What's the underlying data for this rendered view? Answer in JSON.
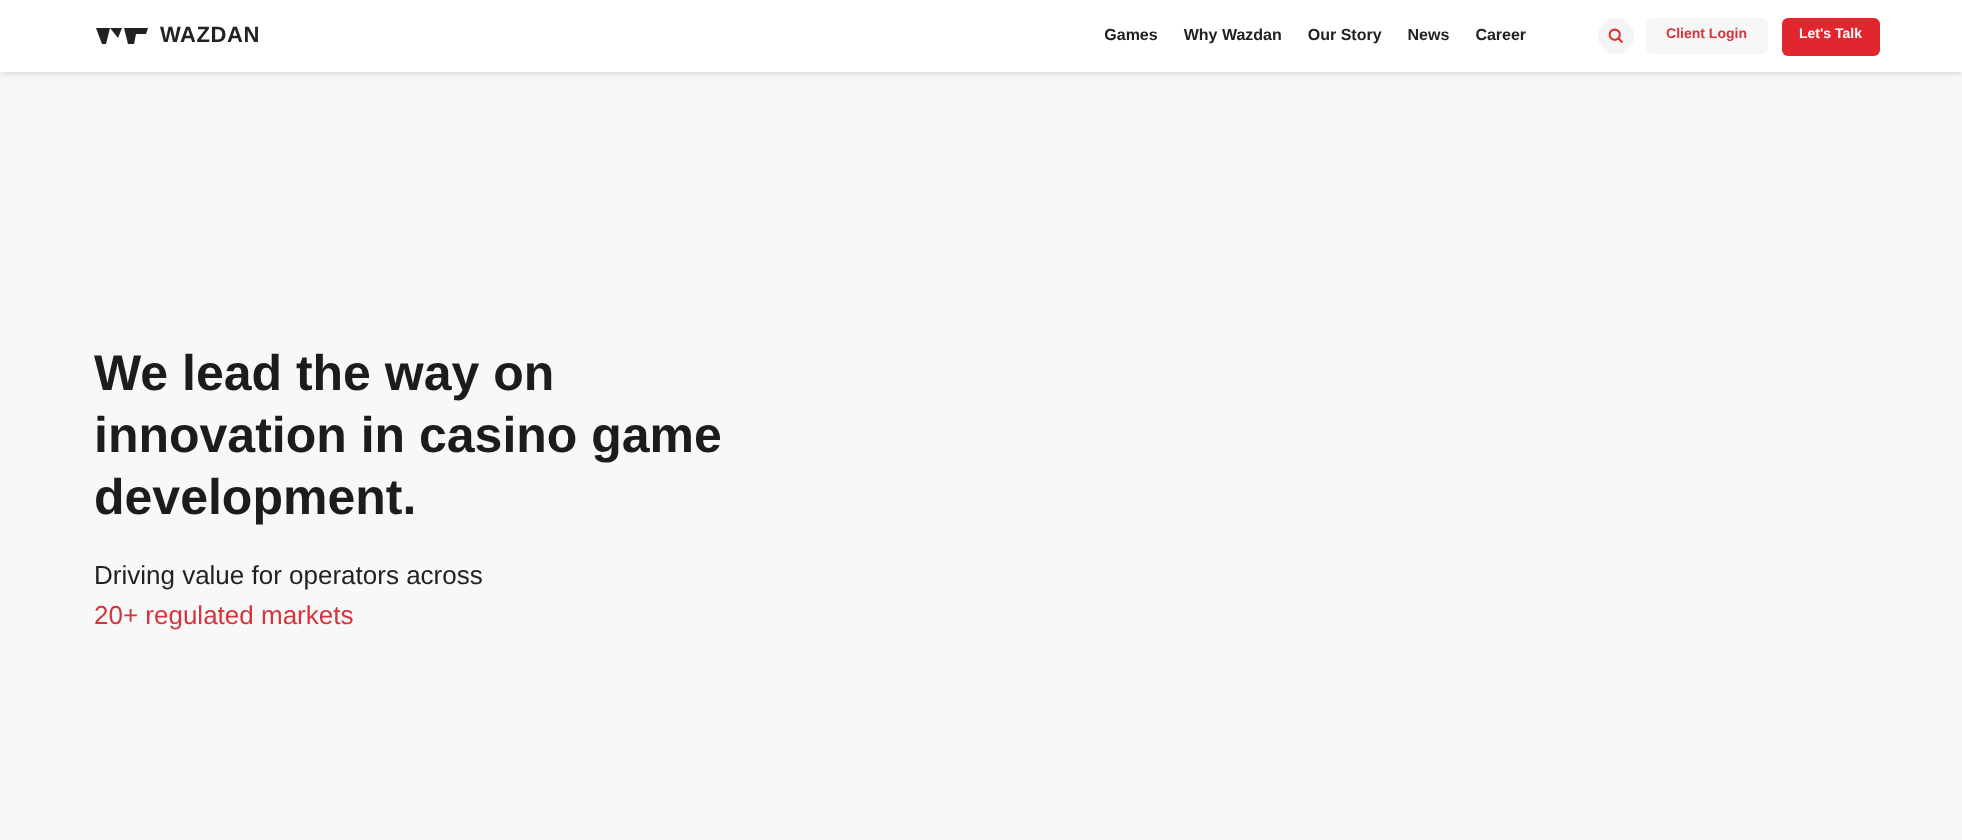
{
  "header": {
    "logo": "WAZDAN",
    "nav": [
      "Games",
      "Why Wazdan",
      "Our Story",
      "News",
      "Career"
    ],
    "client_login": "Client Login",
    "cta": "Let's Talk"
  },
  "hero": {
    "title": "We lead the way on innovation in casino game development.",
    "subtitle": "Driving value for operators across",
    "highlight": "20+ regulated markets"
  }
}
